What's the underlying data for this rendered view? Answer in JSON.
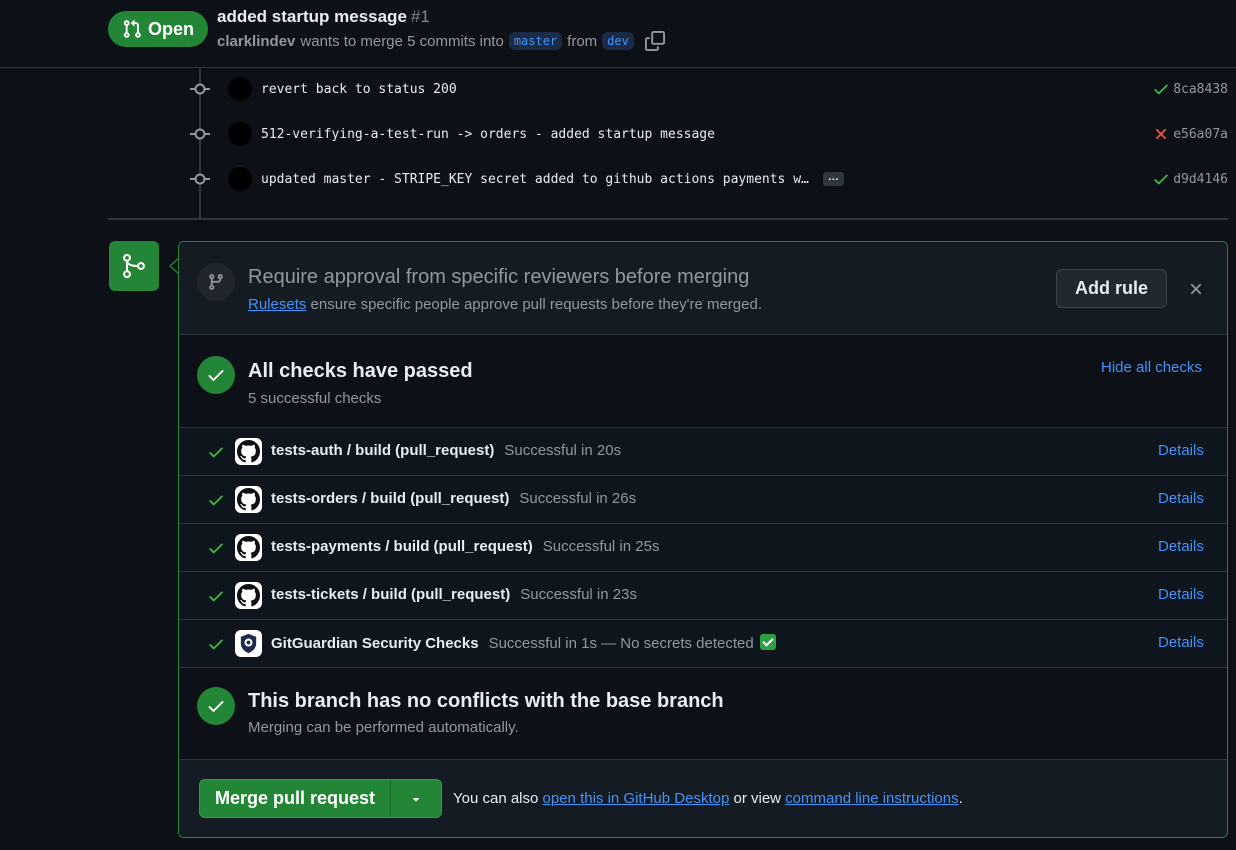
{
  "header": {
    "state": "Open",
    "title": "added startup message",
    "number": "#1",
    "author": "clarklindev",
    "merge_text": "wants to merge 5 commits into",
    "base_branch": "master",
    "from_text": "from",
    "head_branch": "dev"
  },
  "commits": [
    {
      "message": "revert back to status 200",
      "status": "success",
      "sha": "8ca8438"
    },
    {
      "message": "512-verifying-a-test-run -> orders - added startup message",
      "status": "failure",
      "sha": "e56a07a"
    },
    {
      "message": "updated master - STRIPE_KEY secret added to github actions payments w…",
      "status": "success",
      "sha": "d9d4146",
      "more": "…"
    }
  ],
  "ruleset": {
    "title": "Require approval from specific reviewers before merging",
    "link": "Rulesets",
    "description": "ensure specific people approve pull requests before they're merged.",
    "add_button": "Add rule"
  },
  "checks": {
    "title": "All checks have passed",
    "subtitle": "5 successful checks",
    "hide_link": "Hide all checks",
    "items": [
      {
        "name": "tests-auth / build (pull_request)",
        "status": "Successful in 20s",
        "details": "Details",
        "icon": "github-icon"
      },
      {
        "name": "tests-orders / build (pull_request)",
        "status": "Successful in 26s",
        "details": "Details",
        "icon": "github-icon"
      },
      {
        "name": "tests-payments / build (pull_request)",
        "status": "Successful in 25s",
        "details": "Details",
        "icon": "github-icon"
      },
      {
        "name": "tests-tickets / build (pull_request)",
        "status": "Successful in 23s",
        "details": "Details",
        "icon": "github-icon"
      },
      {
        "name": "GitGuardian Security Checks",
        "status": "Successful in 1s — No secrets detected",
        "details": "Details",
        "icon": "gitguardian-icon"
      }
    ]
  },
  "conflicts": {
    "title": "This branch has no conflicts with the base branch",
    "subtitle": "Merging can be performed automatically."
  },
  "merge": {
    "button": "Merge pull request",
    "hint_prefix": "You can also",
    "desktop_link": "open this in GitHub Desktop",
    "hint_middle": "or view",
    "cli_link": "command line instructions",
    "hint_suffix": "."
  },
  "colors": {
    "background": "#0d1117",
    "success": "#238636",
    "link": "#4493f8",
    "failure": "#f85149",
    "muted": "#9198a1"
  }
}
